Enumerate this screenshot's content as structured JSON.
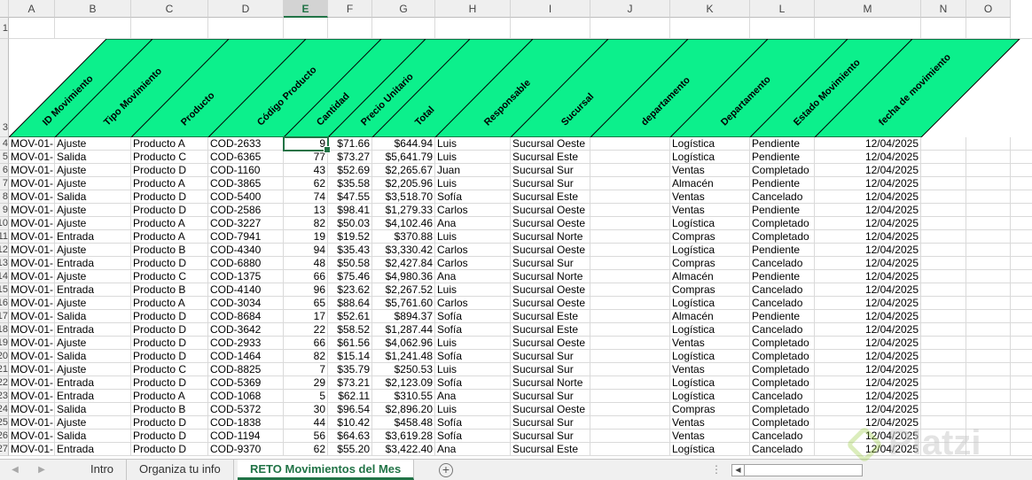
{
  "sheet": {
    "column_letters": [
      "A",
      "B",
      "C",
      "D",
      "E",
      "F",
      "G",
      "H",
      "I",
      "J",
      "K",
      "L",
      "M",
      "N",
      "O"
    ],
    "selected_column": "E",
    "header_row_numbers": [
      "1",
      "3"
    ],
    "row_numbers": [
      "4",
      "5",
      "6",
      "7",
      "8",
      "9",
      "10",
      "11",
      "12",
      "13",
      "14",
      "15",
      "16",
      "17",
      "18",
      "19",
      "20",
      "21",
      "22",
      "23",
      "24",
      "25",
      "26",
      "27"
    ],
    "header_fill_color": "#0cf08c",
    "header_labels": [
      "ID Movimiento",
      "Tipo Movimiento",
      "Producto",
      "Código Producto",
      "Cantidad",
      "Precio Unitario",
      "Total",
      "Responsable",
      "Sucursal",
      "departamento",
      "Departamento",
      "Estado Movimiento",
      "fecha de movimiento"
    ],
    "rows": [
      [
        "MOV-01-",
        "Ajuste",
        "Producto A",
        "COD-2633",
        "9",
        "$71.66",
        "$644.94",
        "Luis",
        "Sucursal Oeste",
        "",
        "Logística",
        "Pendiente",
        "12/04/2025"
      ],
      [
        "MOV-01-",
        "Salida",
        "Producto C",
        "COD-6365",
        "77",
        "$73.27",
        "$5,641.79",
        "Luis",
        "Sucursal Este",
        "",
        "Logística",
        "Pendiente",
        "12/04/2025"
      ],
      [
        "MOV-01-",
        "Ajuste",
        "Producto D",
        "COD-1160",
        "43",
        "$52.69",
        "$2,265.67",
        "Juan",
        "Sucursal Sur",
        "",
        "Ventas",
        "Completado",
        "12/04/2025"
      ],
      [
        "MOV-01-",
        "Ajuste",
        "Producto A",
        "COD-3865",
        "62",
        "$35.58",
        "$2,205.96",
        "Luis",
        "Sucursal Sur",
        "",
        "Almacén",
        "Pendiente",
        "12/04/2025"
      ],
      [
        "MOV-01-",
        "Salida",
        "Producto D",
        "COD-5400",
        "74",
        "$47.55",
        "$3,518.70",
        "Sofía",
        "Sucursal Este",
        "",
        "Ventas",
        "Cancelado",
        "12/04/2025"
      ],
      [
        "MOV-01-",
        "Ajuste",
        "Producto D",
        "COD-2586",
        "13",
        "$98.41",
        "$1,279.33",
        "Carlos",
        "Sucursal Oeste",
        "",
        "Ventas",
        "Pendiente",
        "12/04/2025"
      ],
      [
        "MOV-01-",
        "Ajuste",
        "Producto A",
        "COD-3227",
        "82",
        "$50.03",
        "$4,102.46",
        "Ana",
        "Sucursal Oeste",
        "",
        "Logística",
        "Completado",
        "12/04/2025"
      ],
      [
        "MOV-01-",
        "Entrada",
        "Producto A",
        "COD-7941",
        "19",
        "$19.52",
        "$370.88",
        "Luis",
        "Sucursal Norte",
        "",
        "Compras",
        "Completado",
        "12/04/2025"
      ],
      [
        "MOV-01-",
        "Ajuste",
        "Producto B",
        "COD-4340",
        "94",
        "$35.43",
        "$3,330.42",
        "Carlos",
        "Sucursal Oeste",
        "",
        "Logística",
        "Pendiente",
        "12/04/2025"
      ],
      [
        "MOV-01-",
        "Entrada",
        "Producto D",
        "COD-6880",
        "48",
        "$50.58",
        "$2,427.84",
        "Carlos",
        "Sucursal Sur",
        "",
        "Compras",
        "Cancelado",
        "12/04/2025"
      ],
      [
        "MOV-01-",
        "Ajuste",
        "Producto C",
        "COD-1375",
        "66",
        "$75.46",
        "$4,980.36",
        "Ana",
        "Sucursal Norte",
        "",
        "Almacén",
        "Pendiente",
        "12/04/2025"
      ],
      [
        "MOV-01-",
        "Entrada",
        "Producto B",
        "COD-4140",
        "96",
        "$23.62",
        "$2,267.52",
        "Luis",
        "Sucursal Oeste",
        "",
        "Compras",
        "Cancelado",
        "12/04/2025"
      ],
      [
        "MOV-01-",
        "Ajuste",
        "Producto A",
        "COD-3034",
        "65",
        "$88.64",
        "$5,761.60",
        "Carlos",
        "Sucursal Oeste",
        "",
        "Logística",
        "Cancelado",
        "12/04/2025"
      ],
      [
        "MOV-01-",
        "Salida",
        "Producto D",
        "COD-8684",
        "17",
        "$52.61",
        "$894.37",
        "Sofía",
        "Sucursal Este",
        "",
        "Almacén",
        "Pendiente",
        "12/04/2025"
      ],
      [
        "MOV-01-",
        "Entrada",
        "Producto D",
        "COD-3642",
        "22",
        "$58.52",
        "$1,287.44",
        "Sofía",
        "Sucursal Este",
        "",
        "Logística",
        "Cancelado",
        "12/04/2025"
      ],
      [
        "MOV-01-",
        "Ajuste",
        "Producto D",
        "COD-2933",
        "66",
        "$61.56",
        "$4,062.96",
        "Luis",
        "Sucursal Oeste",
        "",
        "Ventas",
        "Completado",
        "12/04/2025"
      ],
      [
        "MOV-01-",
        "Salida",
        "Producto D",
        "COD-1464",
        "82",
        "$15.14",
        "$1,241.48",
        "Sofía",
        "Sucursal Sur",
        "",
        "Logística",
        "Completado",
        "12/04/2025"
      ],
      [
        "MOV-01-",
        "Ajuste",
        "Producto C",
        "COD-8825",
        "7",
        "$35.79",
        "$250.53",
        "Luis",
        "Sucursal Sur",
        "",
        "Ventas",
        "Completado",
        "12/04/2025"
      ],
      [
        "MOV-01-",
        "Entrada",
        "Producto D",
        "COD-5369",
        "29",
        "$73.21",
        "$2,123.09",
        "Sofía",
        "Sucursal Norte",
        "",
        "Logística",
        "Completado",
        "12/04/2025"
      ],
      [
        "MOV-01-",
        "Entrada",
        "Producto A",
        "COD-1068",
        "5",
        "$62.11",
        "$310.55",
        "Ana",
        "Sucursal Sur",
        "",
        "Logística",
        "Cancelado",
        "12/04/2025"
      ],
      [
        "MOV-01-",
        "Salida",
        "Producto B",
        "COD-5372",
        "30",
        "$96.54",
        "$2,896.20",
        "Luis",
        "Sucursal Oeste",
        "",
        "Compras",
        "Completado",
        "12/04/2025"
      ],
      [
        "MOV-01-",
        "Ajuste",
        "Producto D",
        "COD-1838",
        "44",
        "$10.42",
        "$458.48",
        "Sofía",
        "Sucursal Sur",
        "",
        "Ventas",
        "Completado",
        "12/04/2025"
      ],
      [
        "MOV-01-",
        "Salida",
        "Producto D",
        "COD-1194",
        "56",
        "$64.63",
        "$3,619.28",
        "Sofía",
        "Sucursal Sur",
        "",
        "Ventas",
        "Cancelado",
        "12/04/2025"
      ],
      [
        "MOV-01-",
        "Entrada",
        "Producto D",
        "COD-9370",
        "62",
        "$55.20",
        "$3,422.40",
        "Ana",
        "Sucursal Este",
        "",
        "Logística",
        "Cancelado",
        "12/04/2025"
      ]
    ]
  },
  "tabs": [
    {
      "label": "Intro",
      "active": false
    },
    {
      "label": "Organiza tu info",
      "active": false
    },
    {
      "label": "RETO Movimientos del Mes",
      "active": true
    }
  ],
  "tabbar": {
    "add_sheet_symbol": "+",
    "prev_arrow": "◀",
    "next_arrow": "▶",
    "dots": "⋮",
    "scroll_left_arrow": "◀"
  },
  "watermark": {
    "text": "Platzi"
  },
  "colors": {
    "accent": "#217346",
    "header_fill": "#0cf08c"
  }
}
